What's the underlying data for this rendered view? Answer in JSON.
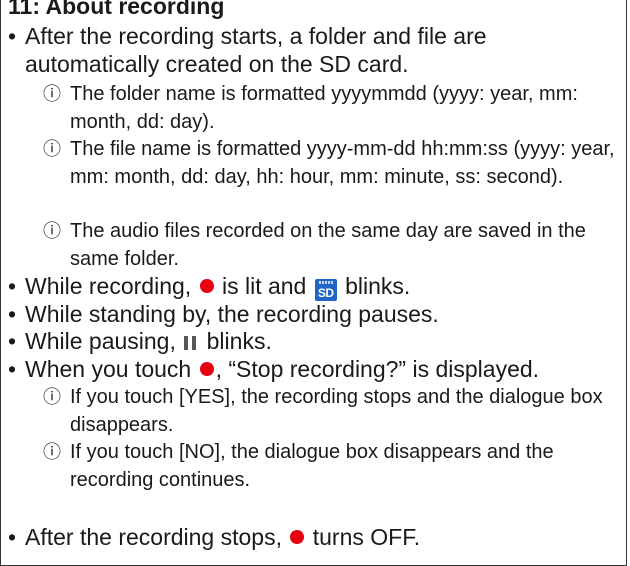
{
  "section": {
    "heading": "11: About recording"
  },
  "bullet_char": "•",
  "note_mark": "ⓘ",
  "items": {
    "b1": "After the recording starts, a folder and file are automatically created on the SD card.",
    "n1": "The folder name is formatted yyyymmdd (yyyy: year, mm: month, dd: day).",
    "n2": "The file name is formatted yyyy-mm-dd hh:mm:ss (yyyy: year, mm: month, dd: day, hh: hour, mm: minute, ss: second).",
    "n3": "The audio files recorded on the same day are saved in the same folder.",
    "b2_a": "While recording, ",
    "b2_b": " is lit and ",
    "b2_c": " blinks.",
    "b3": "While standing by, the recording pauses.",
    "b4_a": "While pausing, ",
    "b4_b": " blinks.",
    "b5_a": "When you touch ",
    "b5_b": ", “Stop recording?” is displayed.",
    "n4": "If you touch [YES], the recording stops and the dialogue box disappears.",
    "n5": "If you touch [NO], the dialogue box disappears and the recording continues.",
    "b6_a": "After the recording stops, ",
    "b6_b": " turns OFF."
  },
  "icons": {
    "sd_label": "SD",
    "record_color": "#e60012",
    "sd_color": "#1f66c7"
  }
}
